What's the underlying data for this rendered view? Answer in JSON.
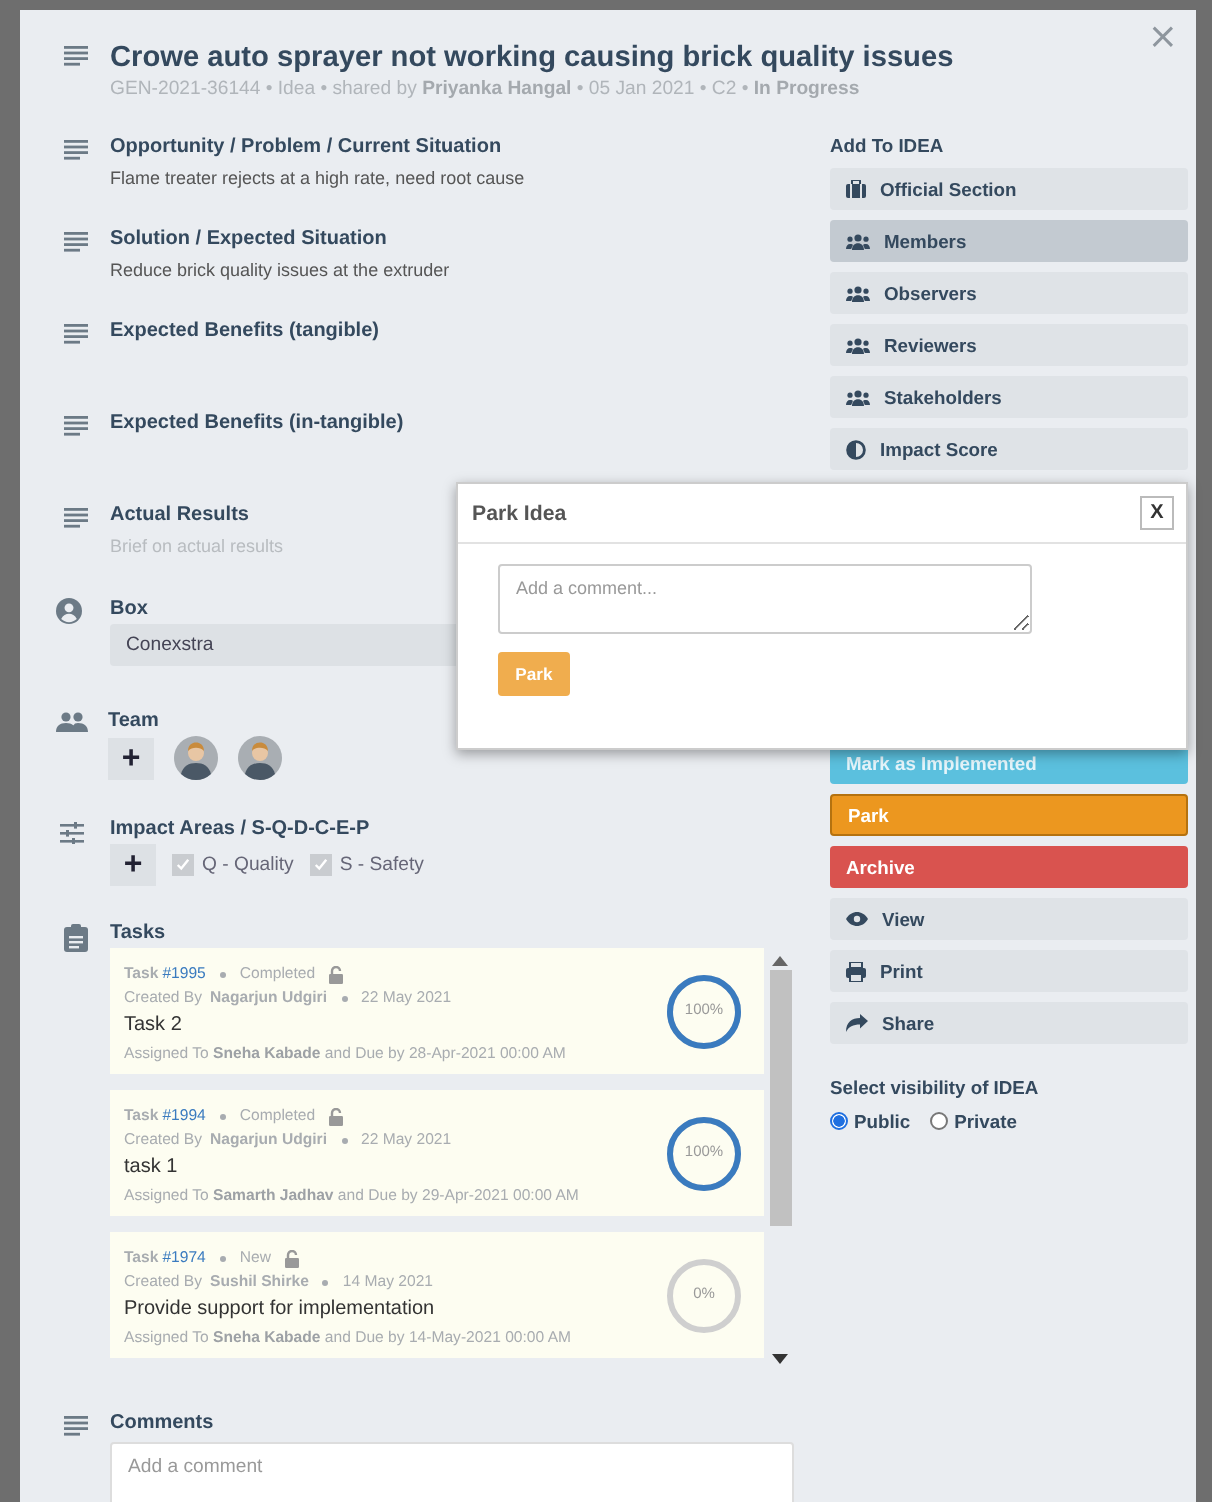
{
  "header": {
    "title": "Crowe auto sprayer not working causing brick quality issues",
    "meta": "GEN-2021-36144 • Idea • shared by **Priyanka Hangal** • 05 Jan 2021 • C2 • **In Progress**",
    "close": "×"
  },
  "sections": [
    {
      "label": "Opportunity / Problem / Current Situation",
      "text": "Flame treater rejects at a high rate, need root cause"
    },
    {
      "label": "Solution / Expected Situation",
      "text": "Reduce brick quality issues at the extruder"
    },
    {
      "label": "Expected Benefits (tangible)"
    },
    {
      "label": "Expected Benefits (in-tangible)"
    },
    {
      "label": "Actual Results",
      "hint": "Brief on actual results"
    }
  ],
  "box": {
    "label": "Box",
    "value": "Conexstra"
  },
  "team": {
    "label": "Team",
    "add": "+",
    "members": [
      {
        "kind": "avatar"
      },
      {
        "kind": "avatar"
      }
    ]
  },
  "impact_areas": {
    "label": "Impact Areas / S-Q-D-C-E-P",
    "add": "+",
    "items": [
      {
        "label": "Q - Quality",
        "checked": true,
        "disabled": true
      },
      {
        "label": "S - Safety",
        "checked": true,
        "disabled": true
      }
    ]
  },
  "tasks": {
    "label": "Tasks",
    "items": [
      {
        "prefix": "Task",
        "number": "#1995",
        "status": "Completed",
        "created_prefix": "Created By",
        "created_by": "Nagarjun Udgiri",
        "date": "22 May 2021",
        "title": "Task 2",
        "assigned": "Assigned To **Sneha Kabade** and Due by 28-Apr-2021 00:00 AM",
        "progress": "100%",
        "level": 1
      },
      {
        "prefix": "Task",
        "number": "#1994",
        "status": "Completed",
        "created_prefix": "Created By",
        "created_by": "Nagarjun Udgiri",
        "date": "22 May 2021",
        "title": "task 1",
        "assigned": "Assigned To **Samarth Jadhav** and Due by 29-Apr-2021 00:00 AM",
        "progress": "100%",
        "level": 1
      },
      {
        "prefix": "Task",
        "number": "#1974",
        "status": "New",
        "created_prefix": "Created By",
        "created_by": "Sushil Shirke",
        "date": "14 May 2021",
        "title": "Provide support for implementation",
        "assigned": "Assigned To **Sneha Kabade** and Due by 14-May-2021 00:00 AM",
        "progress": "0%",
        "level": 0
      }
    ]
  },
  "comments": {
    "label": "Comments",
    "placeholder": "Add a comment"
  },
  "sidebar": {
    "heading": "Add To IDEA",
    "items": [
      {
        "label": "Official Section",
        "selected": false
      },
      {
        "label": "Members",
        "selected": true
      },
      {
        "label": "Observers",
        "selected": false
      },
      {
        "label": "Reviewers",
        "selected": false
      },
      {
        "label": "Stakeholders",
        "selected": false
      },
      {
        "label": "Impact Score",
        "selected": false
      }
    ]
  },
  "actions": [
    {
      "kind": "info",
      "label": "Mark as Implemented"
    },
    {
      "kind": "warning",
      "label": "Park"
    },
    {
      "kind": "danger",
      "label": "Archive"
    },
    {
      "kind": "default",
      "label": "View"
    },
    {
      "kind": "default",
      "label": "Print"
    },
    {
      "kind": "default",
      "label": "Share"
    }
  ],
  "visibility": {
    "label": "Select visibility of IDEA",
    "options": [
      {
        "label": "Public",
        "selected": true
      },
      {
        "label": "Private",
        "selected": false
      }
    ]
  },
  "dialog": {
    "title": "Park Idea",
    "close": "X",
    "placeholder": "Add a comment...",
    "button": "Park"
  }
}
